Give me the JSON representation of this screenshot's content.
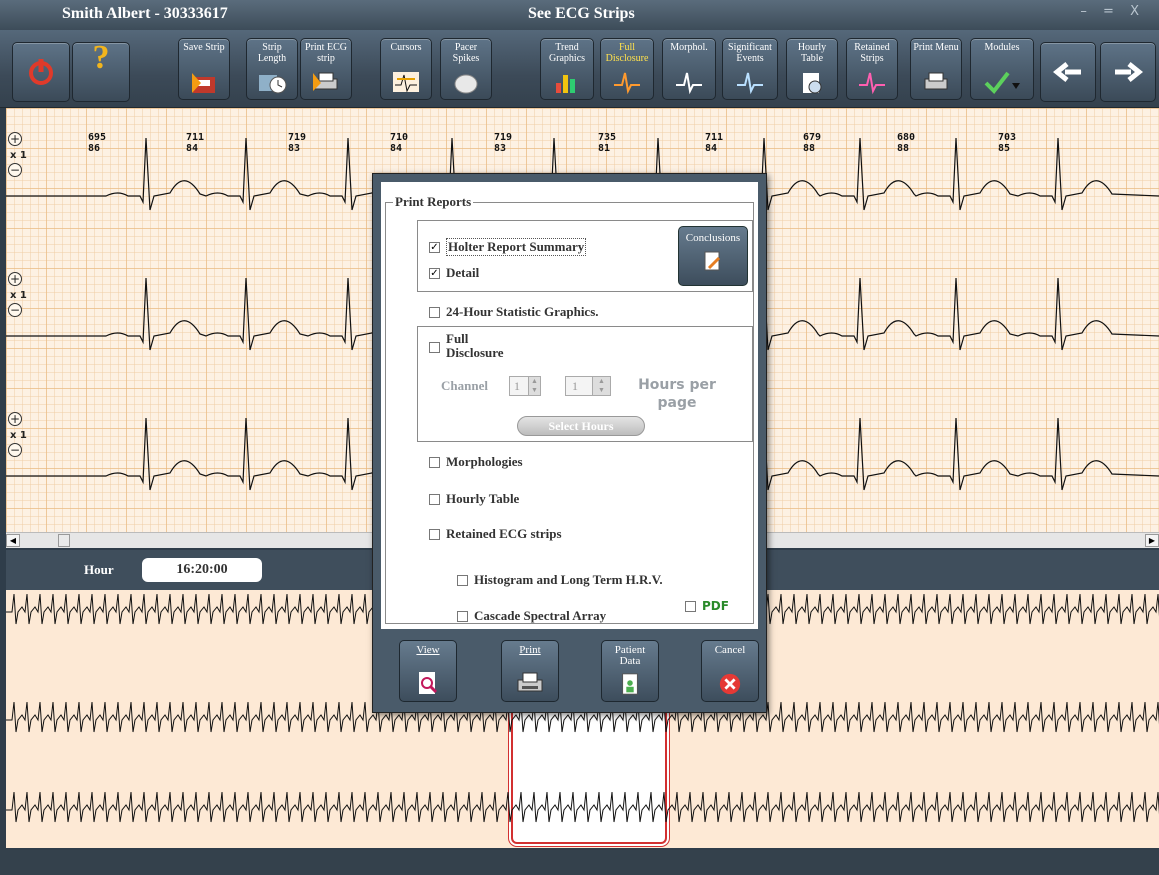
{
  "title_bar": {
    "patient": "Smith Albert - 30333617",
    "window_title": "See ECG Strips",
    "controls": "– = X"
  },
  "toolbar": {
    "buttons": [
      {
        "label": "Save Strip"
      },
      {
        "label": "Strip Length"
      },
      {
        "label": "Print ECG strip"
      },
      {
        "label": "Cursors"
      },
      {
        "label": "Pacer Spikes"
      },
      {
        "label": "Trend Graphics"
      },
      {
        "label": "Full Disclosure"
      },
      {
        "label": "Morphol."
      },
      {
        "label": "Significant Events"
      },
      {
        "label": "Hourly Table"
      },
      {
        "label": "Retained Strips"
      },
      {
        "label": "Print Menu"
      },
      {
        "label": "Modules"
      }
    ],
    "help_label": "?"
  },
  "ecg": {
    "gain": "x 1",
    "beats": [
      {
        "rr": "695",
        "hr": "86"
      },
      {
        "rr": "711",
        "hr": "84"
      },
      {
        "rr": "719",
        "hr": "83"
      },
      {
        "rr": "710",
        "hr": "84"
      },
      {
        "rr": "719",
        "hr": "83"
      },
      {
        "rr": "735",
        "hr": "81"
      },
      {
        "rr": "711",
        "hr": "84"
      },
      {
        "rr": "679",
        "hr": "88"
      },
      {
        "rr": "680",
        "hr": "88"
      },
      {
        "rr": "703",
        "hr": "85"
      }
    ]
  },
  "hour_bar": {
    "label": "Hour",
    "value": "16:20:00"
  },
  "dialog": {
    "group_title": "Print Reports",
    "conclusions_label": "Conclusions",
    "holter_summary": "Holter Report Summary",
    "detail": "Detail",
    "stat_graphics": "24-Hour Statistic Graphics.",
    "full_disclosure_1": "Full",
    "full_disclosure_2": "Disclosure",
    "channel_label": "Channel",
    "channel_from": "1",
    "channel_to": "1",
    "hours_per_page_1": "Hours per",
    "hours_per_page_2": "page",
    "select_hours": "Select Hours",
    "morphologies": "Morphologies",
    "hourly_table": "Hourly Table",
    "retained_strips": "Retained ECG strips",
    "histogram": "Histogram and Long Term H.R.V.",
    "cascade": "Cascade Spectral Array",
    "pdf": "PDF",
    "buttons": {
      "view": "View",
      "print": "Print",
      "patient_1": "Patient",
      "patient_2": "Data",
      "cancel": "Cancel"
    }
  }
}
